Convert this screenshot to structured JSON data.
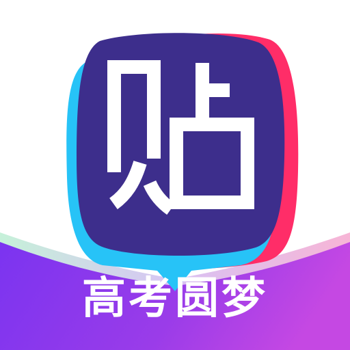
{
  "app": {
    "logo_text": "贴",
    "banner_text": "高考圆梦"
  },
  "colors": {
    "bubble_fill": "#3d2e8c",
    "bubble_shadow_red": "#ff2d68",
    "bubble_shadow_cyan": "#27c3f7",
    "banner_purple": "#7b34f0",
    "banner_violet": "#a341e8",
    "banner_pink": "#f062d8",
    "wave_green": "#c6f1d9",
    "wave_pink": "#f7b5d6",
    "logo_glyph": "#ffffff",
    "background": "#ffffff"
  },
  "icons": {
    "logo": "speech-bubble-logo-icon"
  }
}
